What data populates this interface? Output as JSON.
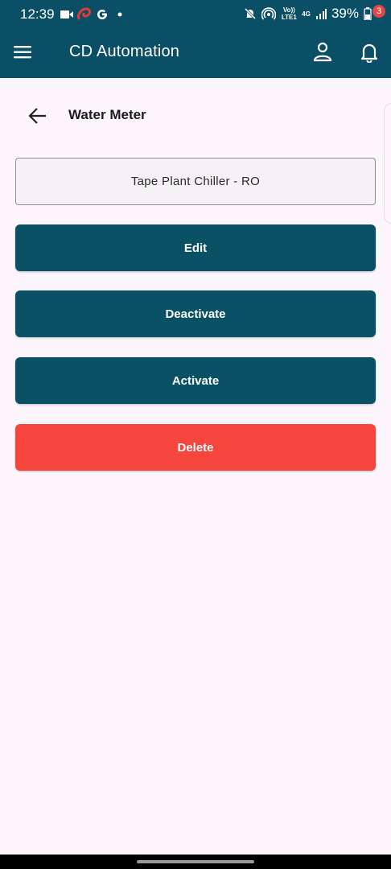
{
  "status_bar": {
    "time": "12:39",
    "battery": "39%",
    "network_label": "Vo)) LTE1",
    "network_type": "4G"
  },
  "app_bar": {
    "title": "CD Automation",
    "notification_count": "3"
  },
  "page": {
    "title": "Water Meter",
    "item_name": "Tape Plant Chiller - RO"
  },
  "actions": {
    "edit_label": "Edit",
    "deactivate_label": "Deactivate",
    "activate_label": "Activate",
    "delete_label": "Delete"
  },
  "colors": {
    "primary": "#0b4f66",
    "danger": "#f5453d",
    "background": "#fcf6fc"
  },
  "icons": [
    "video-icon",
    "airtel-icon",
    "google-icon",
    "mute-icon",
    "hotspot-icon",
    "signal-icon",
    "battery-icon",
    "menu-icon",
    "user-icon",
    "bell-icon",
    "back-arrow-icon"
  ]
}
